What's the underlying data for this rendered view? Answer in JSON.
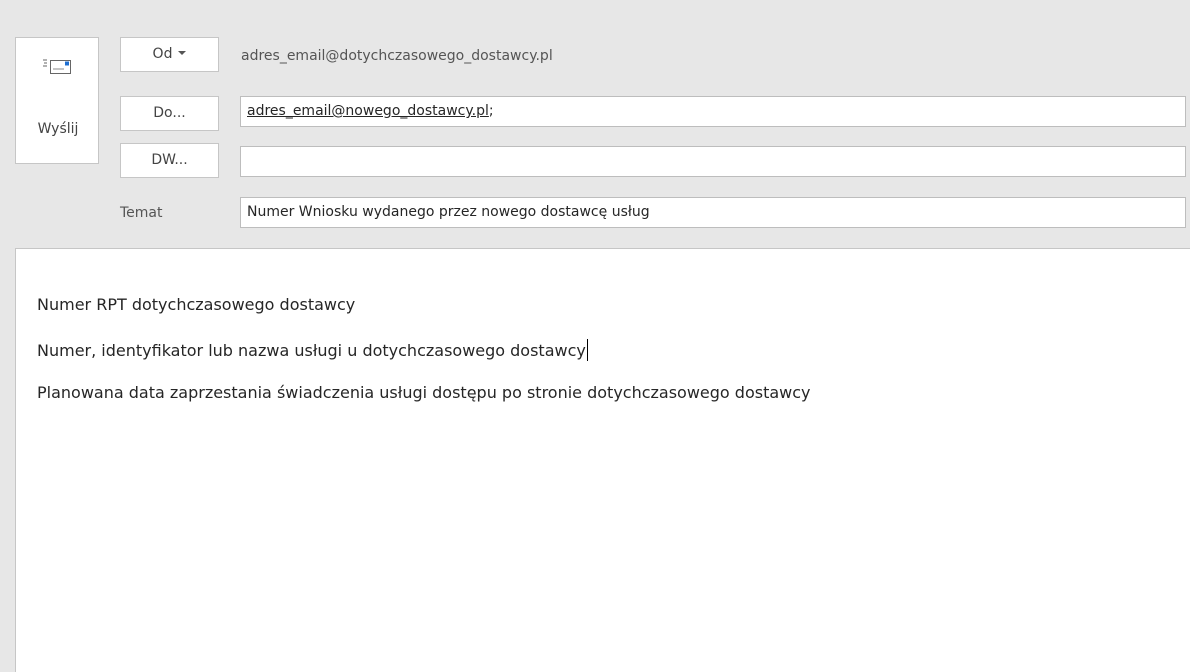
{
  "compose": {
    "send_label": "Wyślij",
    "from_button_label": "Od",
    "from_value": "adres_email@dotychczasowego_dostawcy.pl",
    "to_button_label": "Do...",
    "to_recipient": "adres_email@nowego_dostawcy.pl",
    "to_separator": ";",
    "cc_button_label": "DW...",
    "cc_value": "",
    "subject_label": "Temat",
    "subject_value": "Numer Wniosku wydanego przez nowego dostawcę usług"
  },
  "body": {
    "lines": [
      "Numer RPT dotychczasowego dostawcy",
      "Numer, identyfikator lub nazwa usługi u dotychczasowego dostawcy",
      "Planowana data zaprzestania świadczenia usługi dostępu po stronie dotychczasowego dostawcy"
    ]
  },
  "icons": {
    "send": "envelope-send-icon",
    "from_dropdown": "chevron-down-icon"
  },
  "colors": {
    "header_background": "#e7e7e7",
    "envelope_accent": "#1f6fd1"
  }
}
